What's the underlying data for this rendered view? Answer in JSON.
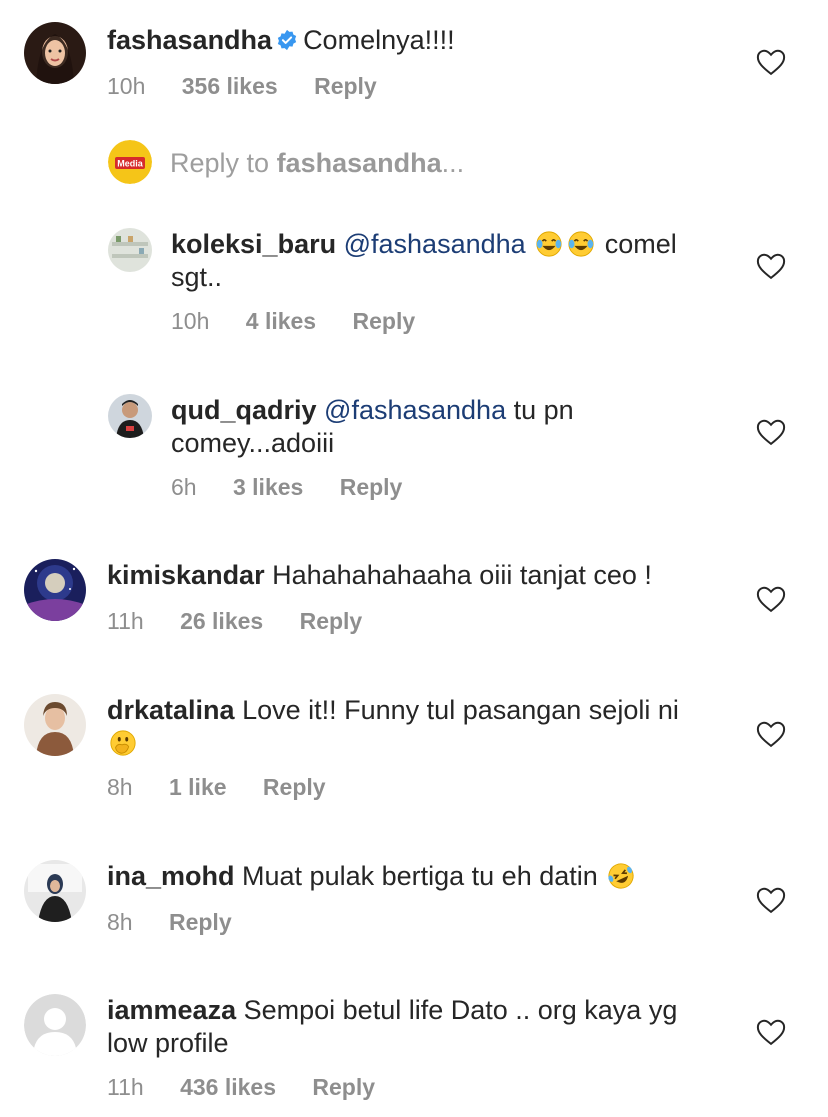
{
  "colors": {
    "text": "#262626",
    "meta": "#8e8e8e",
    "mention": "#1c3d75",
    "verified": "#3897f0"
  },
  "comments": [
    {
      "username": "fashasandha",
      "verified": true,
      "text": "Comelnya!!!!",
      "time": "10h",
      "likes": "356 likes",
      "reply": "Reply"
    },
    {
      "reply_prompt": "Reply to ",
      "reply_user": "fashasandha",
      "reply_ellipsis": "..."
    },
    {
      "username": "koleksi_baru",
      "mention": "@fashasandha",
      "emoji": [
        "face-with-tears-of-joy",
        "face-with-tears-of-joy"
      ],
      "text": "comel sgt..",
      "time": "10h",
      "likes": "4 likes",
      "reply": "Reply"
    },
    {
      "username": "qud_qadriy",
      "mention": "@fashasandha",
      "text": "tu pn comey...adoiii",
      "time": "6h",
      "likes": "3 likes",
      "reply": "Reply"
    },
    {
      "username": "kimiskandar",
      "text": "Hahahahahaaha oiii tanjat ceo !",
      "time": "11h",
      "likes": "26 likes",
      "reply": "Reply"
    },
    {
      "username": "drkatalina",
      "text": "Love it!! Funny tul pasangan sejoli ni",
      "emoji": [
        "face-with-hand-over-mouth"
      ],
      "time": "8h",
      "likes": "1 like",
      "reply": "Reply"
    },
    {
      "username": "ina_mohd",
      "text": "Muat pulak bertiga tu eh datin",
      "emoji": [
        "rolling-on-floor-laughing"
      ],
      "time": "8h",
      "reply": "Reply"
    },
    {
      "username": "iammeaza",
      "text": "Sempoi betul life Dato .. org kaya yg low profile",
      "time": "11h",
      "likes": "436 likes",
      "reply": "Reply"
    }
  ]
}
